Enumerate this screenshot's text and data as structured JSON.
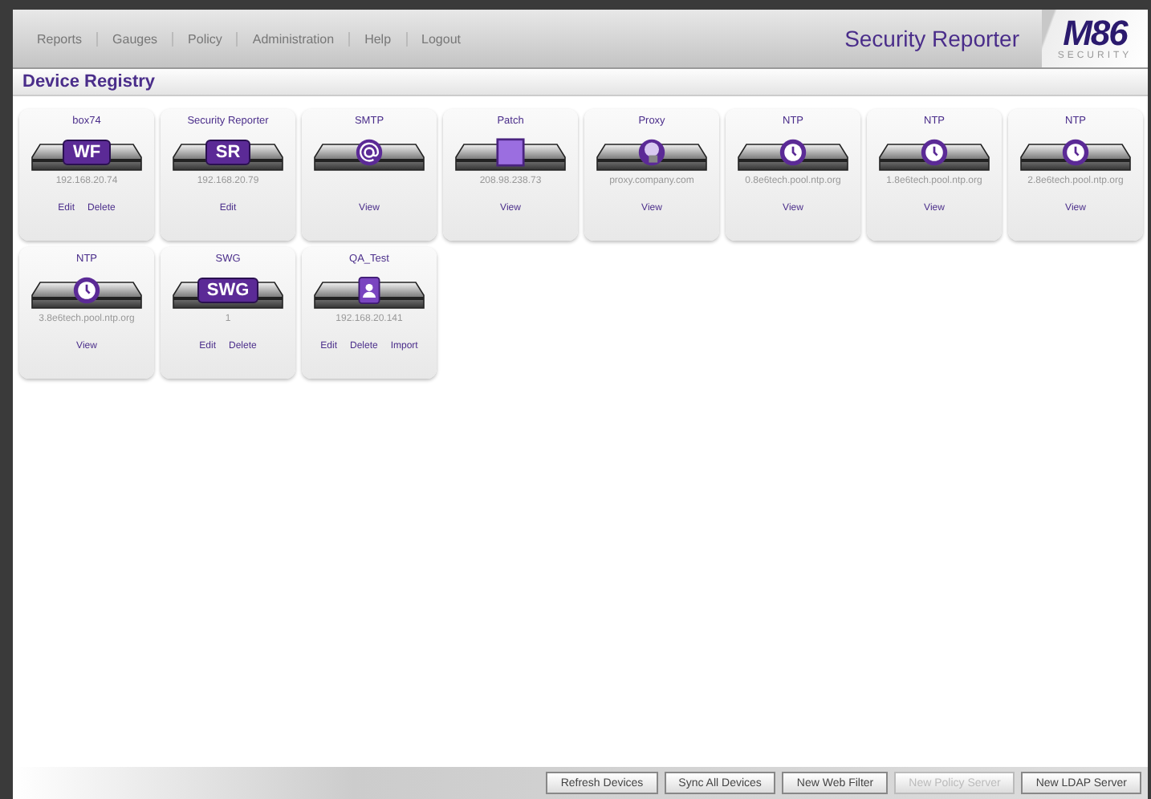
{
  "nav": [
    "Reports",
    "Gauges",
    "Policy",
    "Administration",
    "Help",
    "Logout"
  ],
  "product_title": "Security Reporter",
  "logo": {
    "mark": "M86",
    "sub": "SECURITY"
  },
  "page_title": "Device Registry",
  "devices": [
    {
      "name": "box74",
      "kind": "text",
      "badge": "WF",
      "address": "192.168.20.74",
      "actions": [
        "Edit",
        "Delete"
      ]
    },
    {
      "name": "Security Reporter",
      "kind": "text",
      "badge": "SR",
      "address": "192.168.20.79",
      "actions": [
        "Edit"
      ]
    },
    {
      "name": "SMTP",
      "kind": "at",
      "actions": [
        "View"
      ]
    },
    {
      "name": "Patch",
      "kind": "square",
      "address": "208.98.238.73",
      "actions": [
        "View"
      ]
    },
    {
      "name": "Proxy",
      "kind": "globe",
      "address": "proxy.company.com",
      "actions": [
        "View"
      ]
    },
    {
      "name": "NTP",
      "kind": "clock",
      "address": "0.8e6tech.pool.ntp.org",
      "actions": [
        "View"
      ]
    },
    {
      "name": "NTP",
      "kind": "clock",
      "address": "1.8e6tech.pool.ntp.org",
      "actions": [
        "View"
      ]
    },
    {
      "name": "NTP",
      "kind": "clock",
      "address": "2.8e6tech.pool.ntp.org",
      "actions": [
        "View"
      ]
    },
    {
      "name": "NTP",
      "kind": "clock",
      "address": "3.8e6tech.pool.ntp.org",
      "actions": [
        "View"
      ]
    },
    {
      "name": "SWG",
      "kind": "text",
      "badge": "SWG",
      "address": "1",
      "actions": [
        "Edit",
        "Delete"
      ]
    },
    {
      "name": "QA_Test",
      "kind": "contact",
      "address": "192.168.20.141",
      "actions": [
        "Edit",
        "Delete",
        "Import"
      ]
    }
  ],
  "buttons": [
    {
      "label": "Refresh Devices",
      "disabled": false
    },
    {
      "label": "Sync All Devices",
      "disabled": false
    },
    {
      "label": "New Web Filter",
      "disabled": false
    },
    {
      "label": "New Policy Server",
      "disabled": true
    },
    {
      "label": "New LDAP Server",
      "disabled": false
    }
  ]
}
